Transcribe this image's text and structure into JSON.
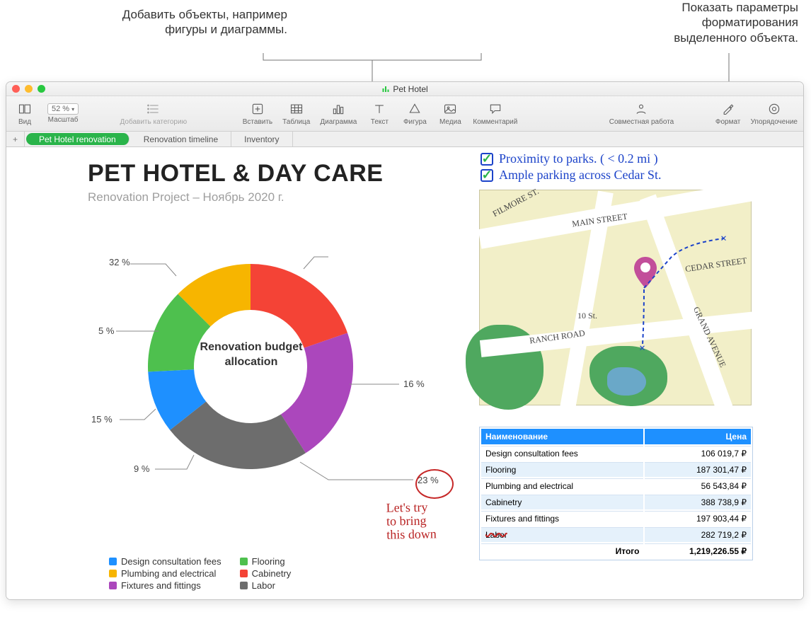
{
  "callouts": {
    "left_line1": "Добавить объекты, например",
    "left_line2": "фигуры и диаграммы.",
    "right_line1": "Показать параметры",
    "right_line2": "форматирования",
    "right_line3": "выделенного объекта."
  },
  "window": {
    "title": "Pet Hotel"
  },
  "toolbar": {
    "view": "Вид",
    "zoom_label": "Масштаб",
    "zoom_value": "52 %",
    "add_category": "Добавить категорию",
    "insert": "Вставить",
    "table": "Таблица",
    "chart": "Диаграмма",
    "text": "Текст",
    "shape": "Фигура",
    "media": "Медиа",
    "comment": "Комментарий",
    "collab": "Совместная работа",
    "format": "Формат",
    "arrange": "Упорядочение"
  },
  "sheets": {
    "active": "Pet Hotel renovation",
    "tab2": "Renovation timeline",
    "tab3": "Inventory"
  },
  "titles": {
    "main": "PET HOTEL & DAY CARE",
    "sub": "Renovation Project – Ноябрь 2020 г."
  },
  "donut": {
    "center_l1": "Renovation budget",
    "center_l2": "allocation",
    "lbl32": "32 %",
    "lbl5": "5 %",
    "lbl15": "15 %",
    "lbl9": "9 %",
    "lbl23": "23 %",
    "lbl16": "16 %"
  },
  "chart_data": {
    "type": "pie",
    "title": "Renovation budget allocation",
    "series": [
      {
        "name": "Design consultation fees",
        "value": 9,
        "color": "#1e90ff"
      },
      {
        "name": "Flooring",
        "value": 15,
        "color": "#4ec04e"
      },
      {
        "name": "Plumbing and electrical",
        "value": 5,
        "color": "#f7b500"
      },
      {
        "name": "Cabinetry",
        "value": 32,
        "color": "#f44336"
      },
      {
        "name": "Fixtures and fittings",
        "value": 16,
        "color": "#ab47bc"
      },
      {
        "name": "Labor",
        "value": 23,
        "color": "#6d6d6d"
      }
    ]
  },
  "legend": {
    "a": "Design consultation fees",
    "b": "Flooring",
    "c": "Plumbing and electrical",
    "d": "Cabinetry",
    "e": "Fixtures and fittings",
    "f": "Labor"
  },
  "colors": {
    "blue": "#1e90ff",
    "green": "#4ec04e",
    "yellow": "#f7b500",
    "red": "#f44336",
    "purple": "#ab47bc",
    "grey": "#6d6d6d"
  },
  "hand": {
    "l1": "Let's try",
    "l2": "to bring",
    "l3": "this down"
  },
  "checks": {
    "c1": "Proximity to parks. ( < 0.2 mi )",
    "c2": "Ample parking across  Cedar St."
  },
  "map_labels": {
    "filmore": "FILMORE ST.",
    "main": "MAIN STREET",
    "cedar": "CEDAR STREET",
    "ranch": "RANCH ROAD",
    "grand": "GRAND AVENUE",
    "tenth": "10 St."
  },
  "table": {
    "h1": "Наименование",
    "h2": "Цена",
    "r1a": "Design consultation fees",
    "r1b": "106 019,7 ₽",
    "r2a": "Flooring",
    "r2b": "187 301,47 ₽",
    "r3a": "Plumbing and electrical",
    "r3b": "56 543,84 ₽",
    "r4a": "Cabinetry",
    "r4b": "388 738,9 ₽",
    "r5a": "Fixtures and fittings",
    "r5b": "197 903,44 ₽",
    "r6a": "Labor",
    "r6b": "282 719,2 ₽",
    "totallbl": "Итого",
    "total": "1,219,226.55 ₽"
  }
}
